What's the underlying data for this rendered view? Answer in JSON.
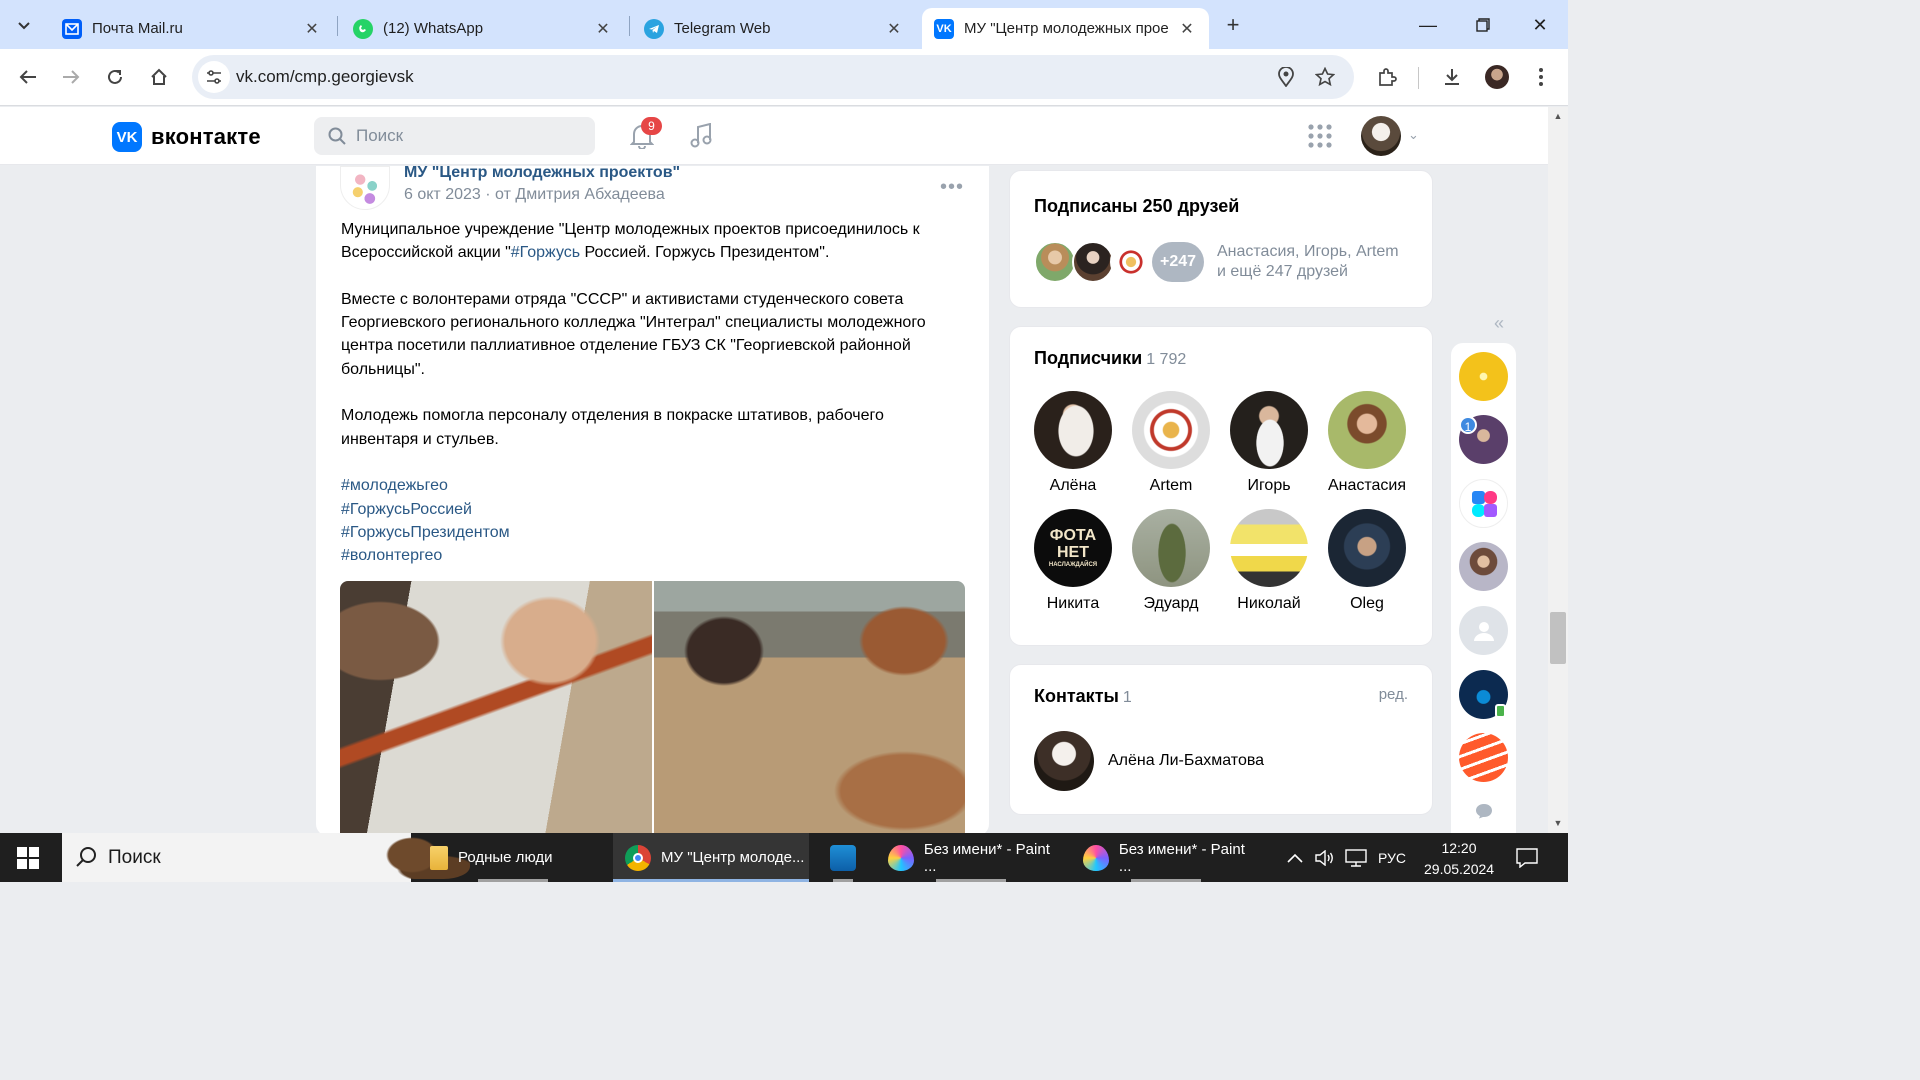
{
  "browser": {
    "tabs": [
      {
        "title": "Почта Mail.ru",
        "favicon": "mail-icon",
        "color": "#005ff9"
      },
      {
        "title": "(12) WhatsApp",
        "favicon": "whatsapp-icon",
        "color": "#25d366"
      },
      {
        "title": "Telegram Web",
        "favicon": "telegram-icon",
        "color": "#2aa3e0"
      },
      {
        "title": "МУ \"Центр молодежных прое",
        "favicon": "vk-icon",
        "color": "#0077ff"
      }
    ],
    "url": "vk.com/cmp.georgievsk"
  },
  "vk": {
    "logo_text": "вконтакте",
    "search_placeholder": "Поиск",
    "notifications_count": "9"
  },
  "post": {
    "author": "МУ \"Центр молодежных проектов\"",
    "date": "6 окт 2023",
    "via": "от Дмитрия Абхадеева",
    "p1_a": "Муниципальное учреждение \"Центр молодежных проектов присоединилось к Всероссийской акции \"",
    "p1_hash": "#Горжусь",
    "p1_b": " Россией. Горжусь Президентом\".",
    "p2": "Вместе с волонтерами отряда \"СССР\" и активистами студенческого совета Георгиевского регионального колледжа \"Интеграл\" специалисты молодежного центра посетили паллиативное отделение ГБУЗ СК \"Георгиевской районной больницы\".",
    "p3": "Молодежь помогла персоналу отделения в покраске штативов, рабочего инвентаря и стульев.",
    "hashtags": [
      "#молодежьгео",
      "#ГоржусьРоссией",
      "#ГоржусьПрезидентом",
      "#волонтергео"
    ]
  },
  "friends_card": {
    "title": "Подписаны 250 друзей",
    "more_badge": "+247",
    "names_line1": "Анастасия, Игорь, Artem",
    "names_line2": "и ещё 247 друзей"
  },
  "subscribers_card": {
    "title": "Подписчики",
    "count": "1 792",
    "people": [
      "Алёна",
      "Artem",
      "Игорь",
      "Анастасия",
      "Никита",
      "Эдуард",
      "Николай",
      "Oleg"
    ],
    "nikita_avatar_text": [
      "ФОТА",
      "НЕТ",
      "НАСЛАЖДАЙСЯ"
    ]
  },
  "contacts_card": {
    "title": "Контакты",
    "count": "1",
    "edit_label": "ред.",
    "contact_name": "Алёна Ли-Бахматова"
  },
  "mini_sidebar": {
    "unread_badge": "1"
  },
  "taskbar": {
    "search_label": "Поиск",
    "apps": [
      {
        "label": "Родные люди"
      },
      {
        "label": "МУ \"Центр молоде..."
      },
      {
        "label": ""
      },
      {
        "label": "Без имени* - Paint ..."
      },
      {
        "label": "Без имени* - Paint ..."
      }
    ],
    "lang": "РУС",
    "time": "12:20",
    "date": "29.05.2024"
  }
}
